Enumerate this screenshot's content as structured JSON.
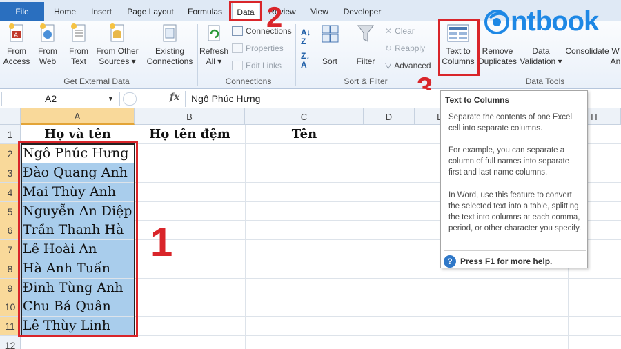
{
  "tabs": {
    "file": "File",
    "home": "Home",
    "insert": "Insert",
    "page_layout": "Page Layout",
    "formulas": "Formulas",
    "data": "Data",
    "review": "Review",
    "view": "View",
    "developer": "Developer"
  },
  "ribbon": {
    "get_external": {
      "from_access": [
        "From",
        "Access"
      ],
      "from_web": [
        "From",
        "Web"
      ],
      "from_text": [
        "From",
        "Text"
      ],
      "from_other": [
        "From Other",
        "Sources ▾"
      ],
      "existing": [
        "Existing",
        "Connections"
      ],
      "label": "Get External Data"
    },
    "connections": {
      "refresh": [
        "Refresh",
        "All ▾"
      ],
      "connections": "Connections",
      "properties": "Properties",
      "edit_links": "Edit Links",
      "label": "Connections"
    },
    "sort_filter": {
      "sort": "Sort",
      "filter": "Filter",
      "clear": "Clear",
      "reapply": "Reapply",
      "advanced": "Advanced",
      "label": "Sort & Filter"
    },
    "data_tools": {
      "text_to_columns": [
        "Text to",
        "Columns"
      ],
      "remove_duplicates": [
        "Remove",
        "Duplicates"
      ],
      "data_validation": [
        "Data",
        "Validation ▾"
      ],
      "consolidate": "Consolidate",
      "what_if": [
        "W",
        "An"
      ],
      "label": "Data Tools"
    }
  },
  "formula_bar": {
    "name_box": "A2",
    "fx": "fx",
    "content": "Ngô Phúc Hưng"
  },
  "grid": {
    "columns": [
      "A",
      "B",
      "C",
      "D",
      "E",
      "F",
      "G",
      "H"
    ],
    "rows": [
      "1",
      "2",
      "3",
      "4",
      "5",
      "6",
      "7",
      "8",
      "9",
      "10",
      "11",
      "12"
    ],
    "header_row": [
      "Họ và tên",
      "Họ tên đệm",
      "Tên"
    ],
    "names": [
      "Ngô Phúc Hưng",
      "Đào Quang Anh",
      "Mai Thùy Anh",
      "Nguyễn An Diệp",
      "Trần Thanh Hà",
      "Lê Hoài An",
      "Hà Anh Tuấn",
      "Đinh Tùng Anh",
      "Chu Bá Quân",
      "Lê Thùy Linh"
    ]
  },
  "tooltip": {
    "title": "Text to Columns",
    "p1": "Separate the contents of one Excel cell into separate columns.",
    "p2": "For example, you can separate a column of full names into separate first and last name columns.",
    "p3": "In Word, use this feature to convert the selected text into a table, splitting the text into columns at each comma, period, or other character you specify.",
    "help": "Press F1 for more help."
  },
  "annotations": {
    "step1": "1",
    "step2": "2",
    "step3": "3"
  },
  "logo": {
    "text": "ntbook",
    "color": "#1e88e5"
  },
  "colors": {
    "accent_red": "#d9252a",
    "selection_fill": "#a9cdec",
    "file_tab": "#2a6fbf"
  }
}
